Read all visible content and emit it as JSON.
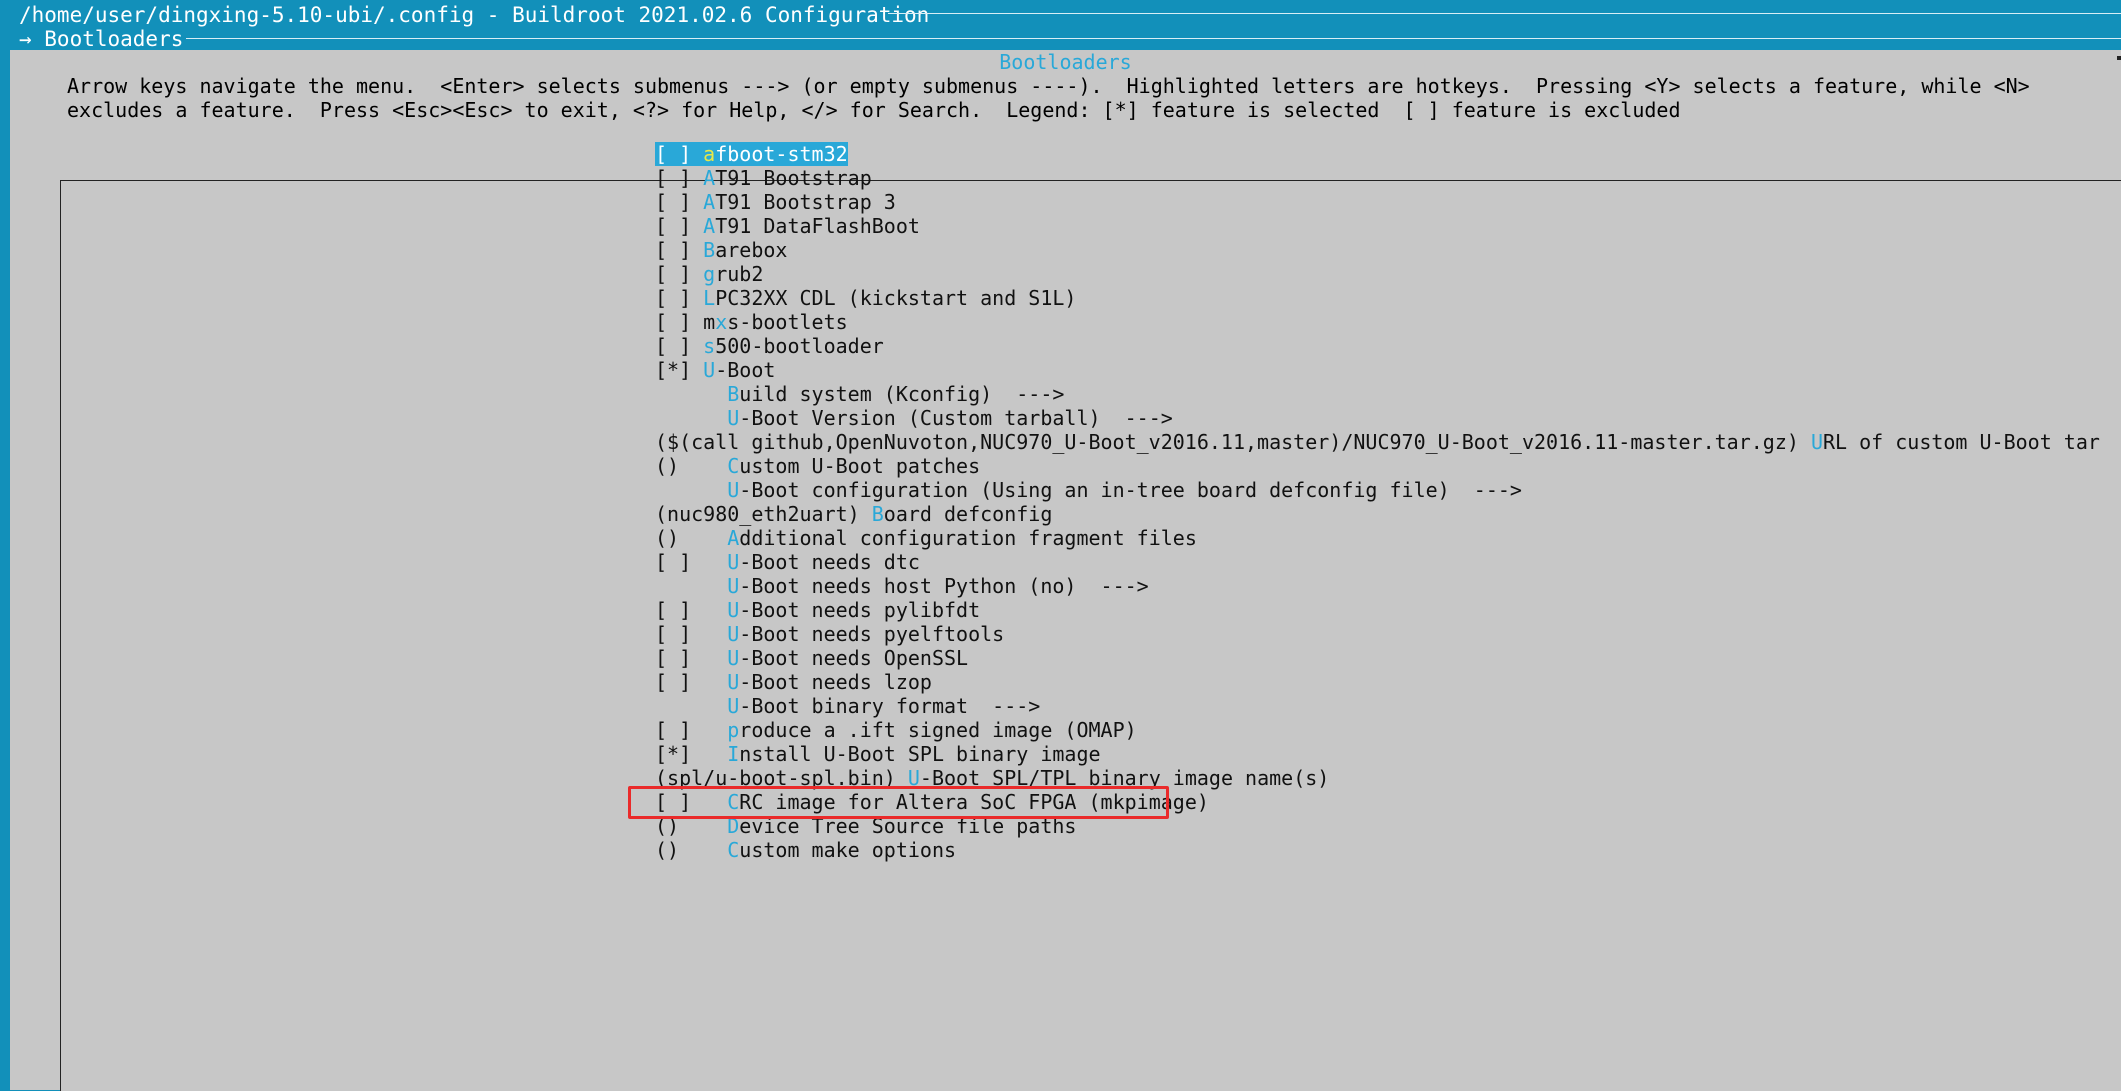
{
  "window": {
    "path_line": "/home/user/dingxing-5.10-ubi/.config - Buildroot 2021.02.6 Configuration",
    "breadcrumb": "→ Bootloaders"
  },
  "dialog": {
    "title": "Bootloaders",
    "help_line1": "Arrow keys navigate the menu.  <Enter> selects submenus ---> (or empty submenus ----).  Highlighted letters are hotkeys.  Pressing <Y> selects a feature, while <N>",
    "help_line2": "excludes a feature.  Press <Esc><Esc> to exit, <?> for Help, </> for Search.  Legend: [*] feature is selected  [ ] feature is excluded"
  },
  "menu": {
    "items": [
      {
        "prefix": "[ ] ",
        "hotkey": "a",
        "rest": "fboot-stm32",
        "selected": true
      },
      {
        "prefix": "[ ] ",
        "hotkey": "A",
        "rest": "T91 Bootstrap"
      },
      {
        "prefix": "[ ] ",
        "hotkey": "A",
        "rest": "T91 Bootstrap 3"
      },
      {
        "prefix": "[ ] ",
        "hotkey": "A",
        "rest": "T91 DataFlashBoot"
      },
      {
        "prefix": "[ ] ",
        "hotkey": "B",
        "rest": "arebox"
      },
      {
        "prefix": "[ ] ",
        "hotkey": "g",
        "rest": "rub2"
      },
      {
        "prefix": "[ ] ",
        "hotkey": "L",
        "rest": "PC32XX CDL (kickstart and S1L)"
      },
      {
        "prefix": "[ ] m",
        "hotkey": "x",
        "rest": "s-bootlets"
      },
      {
        "prefix": "[ ] ",
        "hotkey": "s",
        "rest": "500-bootloader"
      },
      {
        "prefix": "[*] ",
        "hotkey": "U",
        "rest": "-Boot"
      },
      {
        "prefix": "      ",
        "hotkey": "B",
        "rest": "uild system (Kconfig)  --->"
      },
      {
        "prefix": "      ",
        "hotkey": "U",
        "rest": "-Boot Version (Custom tarball)  --->"
      },
      {
        "prefix": "($(call github,OpenNuvoton,NUC970_U-Boot_v2016.11,master)/NUC970_U-Boot_v2016.11-master.tar.gz) ",
        "hotkey": "U",
        "rest": "RL of custom U-Boot tar"
      },
      {
        "prefix": "()    ",
        "hotkey": "C",
        "rest": "ustom U-Boot patches"
      },
      {
        "prefix": "      ",
        "hotkey": "U",
        "rest": "-Boot configuration (Using an in-tree board defconfig file)  --->"
      },
      {
        "prefix": "(nuc980_eth2uart) ",
        "hotkey": "B",
        "rest": "oard defconfig"
      },
      {
        "prefix": "()    ",
        "hotkey": "A",
        "rest": "dditional configuration fragment files"
      },
      {
        "prefix": "[ ]   ",
        "hotkey": "U",
        "rest": "-Boot needs dtc"
      },
      {
        "prefix": "      ",
        "hotkey": "U",
        "rest": "-Boot needs host Python (no)  --->"
      },
      {
        "prefix": "[ ]   ",
        "hotkey": "U",
        "rest": "-Boot needs pylibfdt"
      },
      {
        "prefix": "[ ]   ",
        "hotkey": "U",
        "rest": "-Boot needs pyelftools"
      },
      {
        "prefix": "[ ]   ",
        "hotkey": "U",
        "rest": "-Boot needs OpenSSL"
      },
      {
        "prefix": "[ ]   ",
        "hotkey": "U",
        "rest": "-Boot needs lzop"
      },
      {
        "prefix": "      ",
        "hotkey": "U",
        "rest": "-Boot binary format  --->"
      },
      {
        "prefix": "[ ]   ",
        "hotkey": "p",
        "rest": "roduce a .ift signed image (OMAP)"
      },
      {
        "prefix": "[*]   ",
        "hotkey": "I",
        "rest": "nstall U-Boot SPL binary image"
      },
      {
        "prefix": "(spl/u-boot-spl.bin) ",
        "hotkey": "U",
        "rest": "-Boot SPL/TPL binary image name(s)"
      },
      {
        "prefix": "[ ]   ",
        "hotkey": "C",
        "rest": "RC image for Altera SoC FPGA (mkpimage)"
      },
      {
        "prefix": "()    ",
        "hotkey": "D",
        "rest": "evice Tree Source file paths"
      },
      {
        "prefix": "()    ",
        "hotkey": "C",
        "rest": "ustom make options"
      }
    ]
  },
  "colors": {
    "terminal_bg": "#1290ba",
    "dialog_bg": "#c7c7c7",
    "hotkey": "#29a8d8",
    "annotation_box": "#ea2a2a"
  }
}
